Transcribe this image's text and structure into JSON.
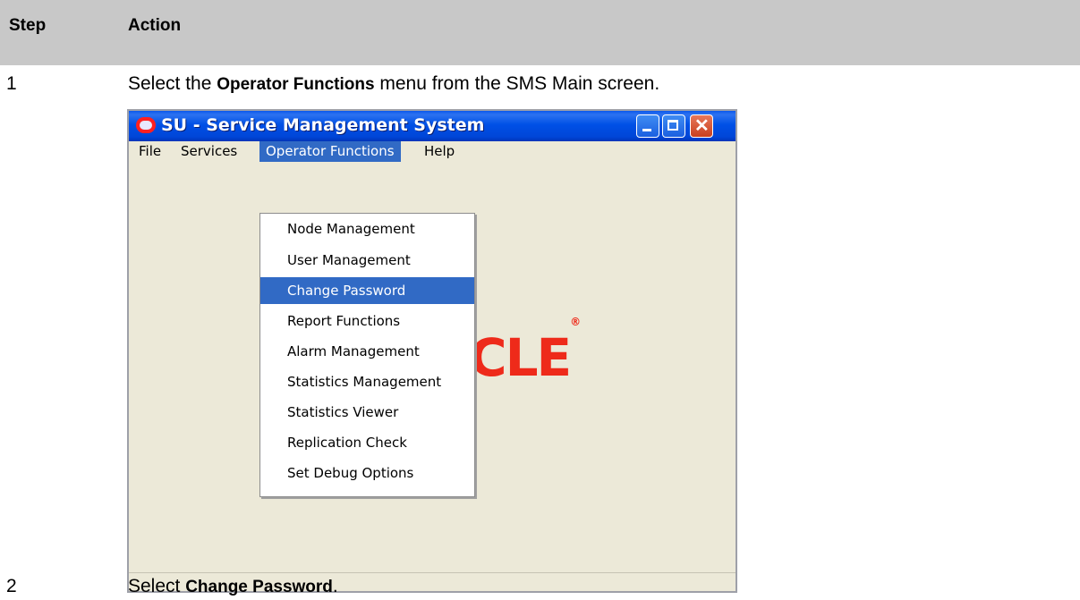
{
  "table": {
    "header_step": "Step",
    "header_action": "Action",
    "rows": [
      {
        "step": "1",
        "pre": "Select the ",
        "bold": "Operator Functions",
        "post": " menu from the SMS Main screen."
      },
      {
        "step": "2",
        "pre": "Select ",
        "bold": "Change Password",
        "post": "."
      }
    ]
  },
  "window": {
    "title": "SU - Service Management System",
    "menu": [
      "File",
      "Services",
      "Operator Functions",
      "Help"
    ],
    "active_menu": "Operator Functions",
    "dropdown_items": [
      "Node Management",
      "User Management",
      "Change Password",
      "Report Functions",
      "Alarm Management",
      "Statistics Management",
      "Statistics Viewer",
      "Replication Check",
      "Set Debug Options"
    ],
    "selected_item": "Change Password",
    "logo_text_visible": "CLE",
    "logo_mark": "®"
  },
  "colors": {
    "header_bg": "#c8c8c8",
    "titlebar": "#0050e6",
    "selection": "#316ac5",
    "logo_red": "#ee2a1a"
  }
}
